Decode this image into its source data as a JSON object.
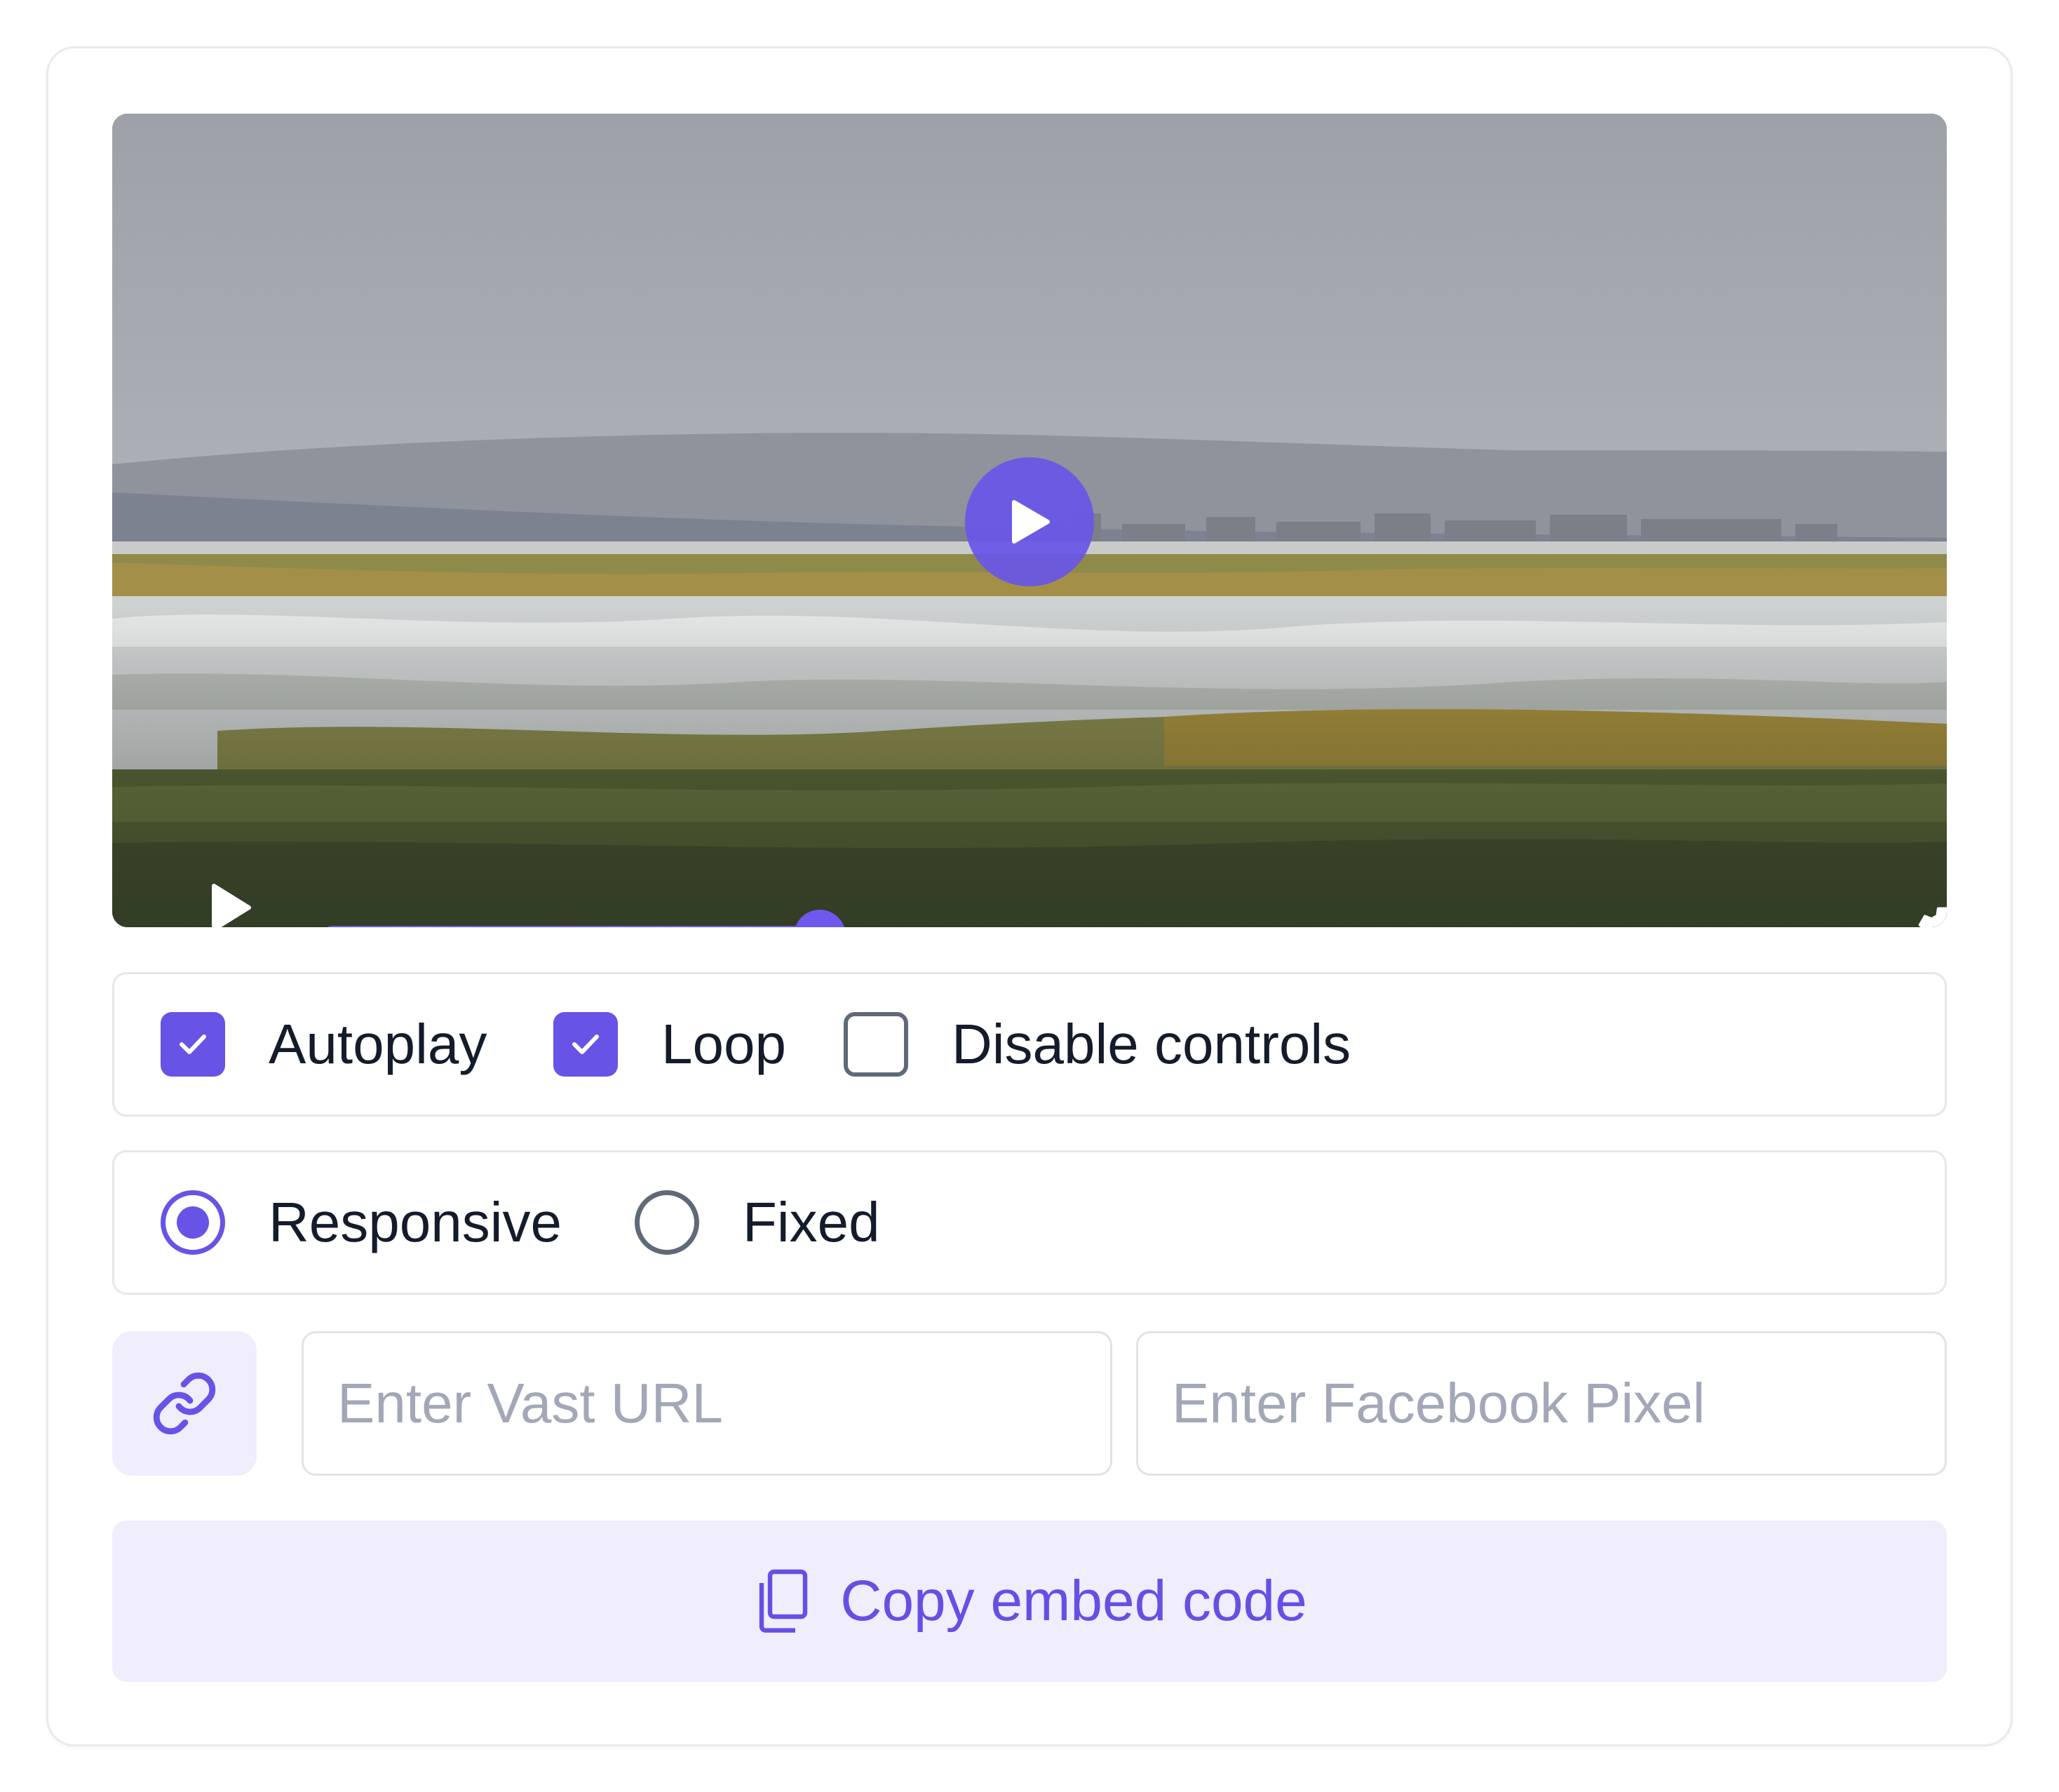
{
  "player": {
    "progress": 0.325,
    "accent_color": "#6E58EE",
    "icons": [
      "play-icon",
      "gear-icon"
    ]
  },
  "options": {
    "checkboxes": [
      {
        "label": "Autoplay",
        "checked": true
      },
      {
        "label": "Loop",
        "checked": true
      },
      {
        "label": "Disable controls",
        "checked": false
      }
    ],
    "size_mode": [
      {
        "label": "Responsive",
        "selected": true
      },
      {
        "label": "Fixed",
        "selected": false
      }
    ]
  },
  "inputs": {
    "vast_url": {
      "value": "",
      "placeholder": "Enter Vast URL"
    },
    "facebook_pixel": {
      "value": "",
      "placeholder": "Enter Facebook Pixel"
    }
  },
  "actions": {
    "copy_label": "Copy embed code"
  },
  "colors": {
    "accent": "#6753E6",
    "accent_soft": "#F0EDFC",
    "text": "#141C2B",
    "placeholder": "#A3A8B8",
    "border": "#E6E7EC"
  }
}
